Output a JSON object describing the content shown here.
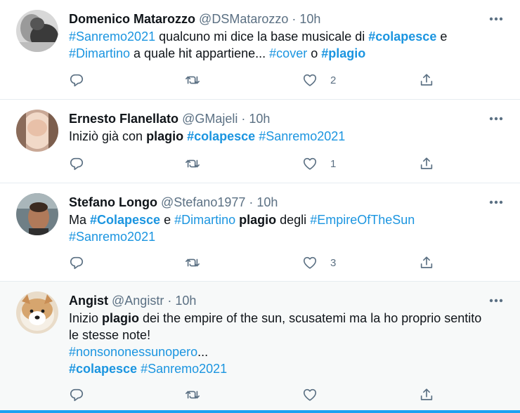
{
  "colors": {
    "link": "#1b95e0",
    "secondary": "#5b7083",
    "hover_bg": "#f7f9f9"
  },
  "tweets": [
    {
      "name": "Domenico Matarozzo",
      "handle": "@DSMatarozzo",
      "dot": "·",
      "time": "10h",
      "text_lines": [
        [
          {
            "t": "#Sanremo2021",
            "k": "tag"
          },
          {
            "t": " qualcuno mi dice la base musicale di ",
            "k": "plain"
          },
          {
            "t": "#colapesce",
            "k": "tagb"
          },
          {
            "t": " e",
            "k": "plain"
          }
        ],
        [
          {
            "t": "#Dimartino",
            "k": "tag"
          },
          {
            "t": " a quale hit appartiene... ",
            "k": "plain"
          },
          {
            "t": "#cover",
            "k": "tag"
          },
          {
            "t": " o ",
            "k": "plain"
          },
          {
            "t": "#plagio",
            "k": "tagb"
          }
        ]
      ],
      "like_count": "2",
      "avatar_icon": "avatar-bw-photo"
    },
    {
      "name": "Ernesto Flanellato",
      "handle": "@GMajeli",
      "dot": "·",
      "time": "10h",
      "text_lines": [
        [
          {
            "t": "Iniziò già con ",
            "k": "plain"
          },
          {
            "t": "plagio",
            "k": "bold"
          },
          {
            "t": " ",
            "k": "plain"
          },
          {
            "t": "#colapesce",
            "k": "tagb"
          },
          {
            "t": " ",
            "k": "plain"
          },
          {
            "t": "#Sanremo2021",
            "k": "tag"
          }
        ]
      ],
      "like_count": "1",
      "avatar_icon": "avatar-photo"
    },
    {
      "name": "Stefano Longo",
      "handle": "@Stefano1977",
      "dot": "·",
      "time": "10h",
      "text_lines": [
        [
          {
            "t": "Ma ",
            "k": "plain"
          },
          {
            "t": "#Colapesce",
            "k": "tagb"
          },
          {
            "t": " e ",
            "k": "plain"
          },
          {
            "t": "#Dimartino",
            "k": "tag"
          },
          {
            "t": " ",
            "k": "plain"
          },
          {
            "t": "plagio",
            "k": "bold"
          },
          {
            "t": " degli ",
            "k": "plain"
          },
          {
            "t": "#EmpireOfTheSun",
            "k": "tag"
          }
        ],
        [
          {
            "t": "#Sanremo2021",
            "k": "tag"
          }
        ]
      ],
      "like_count": "3",
      "avatar_icon": "avatar-photo"
    },
    {
      "name": "Angist",
      "handle": "@Angistr",
      "dot": "·",
      "time": "10h",
      "text_lines": [
        [
          {
            "t": "Inizio ",
            "k": "plain"
          },
          {
            "t": "plagio",
            "k": "bold"
          },
          {
            "t": " dei the empire of the sun, scusatemi ma la ho proprio sentito",
            "k": "plain"
          }
        ],
        [
          {
            "t": "le stesse note!",
            "k": "plain"
          }
        ],
        [
          {
            "t": "#nonsononessunopero",
            "k": "tag"
          },
          {
            "t": "...",
            "k": "plain"
          }
        ],
        [
          {
            "t": "#colapesce",
            "k": "tagb"
          },
          {
            "t": " ",
            "k": "plain"
          },
          {
            "t": "#Sanremo2021",
            "k": "tag"
          }
        ]
      ],
      "like_count": "",
      "avatar_icon": "avatar-dog-photo"
    }
  ],
  "icons": {
    "more": "more-horizontal-icon",
    "reply": "reply-icon",
    "retweet": "retweet-icon",
    "like": "heart-icon",
    "share": "share-icon"
  }
}
